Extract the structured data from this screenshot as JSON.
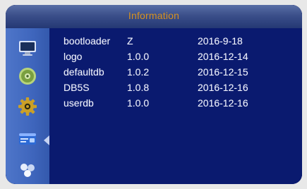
{
  "window": {
    "title": "Information"
  },
  "sidebar": {
    "items": [
      {
        "icon": "monitor-icon"
      },
      {
        "icon": "disc-icon"
      },
      {
        "icon": "gear-icon"
      },
      {
        "icon": "card-icon"
      },
      {
        "icon": "cluster-icon"
      }
    ],
    "selected_index": 3
  },
  "table": {
    "rows": [
      {
        "name": "bootloader",
        "version": "Z",
        "date": "2016-9-18"
      },
      {
        "name": "logo",
        "version": "1.0.0",
        "date": "2016-12-14"
      },
      {
        "name": "defaultdb",
        "version": "1.0.2",
        "date": "2016-12-15"
      },
      {
        "name": "DB5S",
        "version": "1.0.8",
        "date": "2016-12-16"
      },
      {
        "name": "userdb",
        "version": "1.0.0",
        "date": "2016-12-16"
      }
    ]
  },
  "colors": {
    "title_text": "#d6911f",
    "panel_bg": "#0a1a6f",
    "sidebar_bg": "#4e76c9",
    "text": "#f2f4ff"
  }
}
